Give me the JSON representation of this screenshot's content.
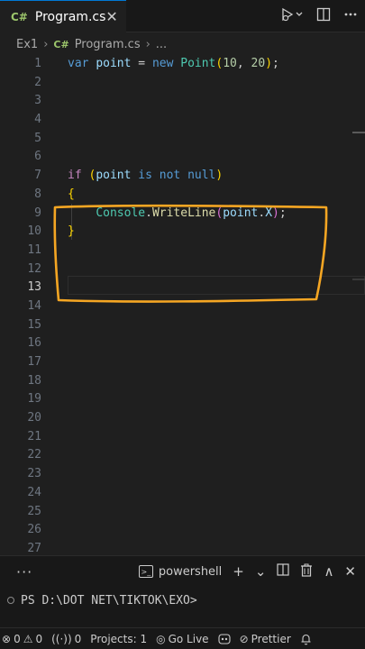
{
  "tab": {
    "lang_icon": "C#",
    "title": "Program.cs",
    "close": "✕"
  },
  "breadcrumb": {
    "project": "Ex1",
    "file": "Program.cs",
    "more": "..."
  },
  "editor": {
    "line_numbers": [
      "1",
      "2",
      "3",
      "4",
      "5",
      "6",
      "7",
      "8",
      "9",
      "10",
      "11",
      "12",
      "13",
      "14",
      "15",
      "16",
      "17",
      "18",
      "19",
      "20",
      "21",
      "22",
      "23",
      "24",
      "25",
      "26",
      "27"
    ],
    "active_line": "13",
    "highlight_color": "#f5a623"
  },
  "code": {
    "l1": {
      "kw1": "var",
      "id": "point",
      "op": " = ",
      "kw2": "new",
      "ty": "Point",
      "p1": "(",
      "n1": "10",
      "comma": ", ",
      "n2": "20",
      "p2": ")",
      "semi": ";"
    },
    "l7": {
      "kw": "if",
      "p1": "(",
      "id": "point",
      "kw2": "is",
      "kw3": "not",
      "kw4": "null",
      "p2": ")"
    },
    "l8": {
      "brace": "{"
    },
    "l9": {
      "ty": "Console",
      "dot": ".",
      "fn": "WriteLine",
      "p1": "(",
      "id": "point",
      "dot2": ".",
      "prop": "X",
      "p2": ")",
      "semi": ";"
    },
    "l10": {
      "brace": "}"
    }
  },
  "panel": {
    "more": "···",
    "terminal_name": "powershell",
    "terminal_icon": ">_",
    "add": "+",
    "chevron": "⌄",
    "split": "◫",
    "trash": "🗑",
    "maximize": "∧",
    "close": "✕",
    "prompt": "PS D:\\DOT NET\\TIKTOK\\EXO>"
  },
  "status": {
    "errors": "0",
    "warnings": "0",
    "ports": "0",
    "projects": "Projects: 1",
    "golive": "Go Live",
    "prettier": "Prettier"
  },
  "colors": {
    "accent": "#0078d4",
    "annotation": "#f5a623"
  }
}
